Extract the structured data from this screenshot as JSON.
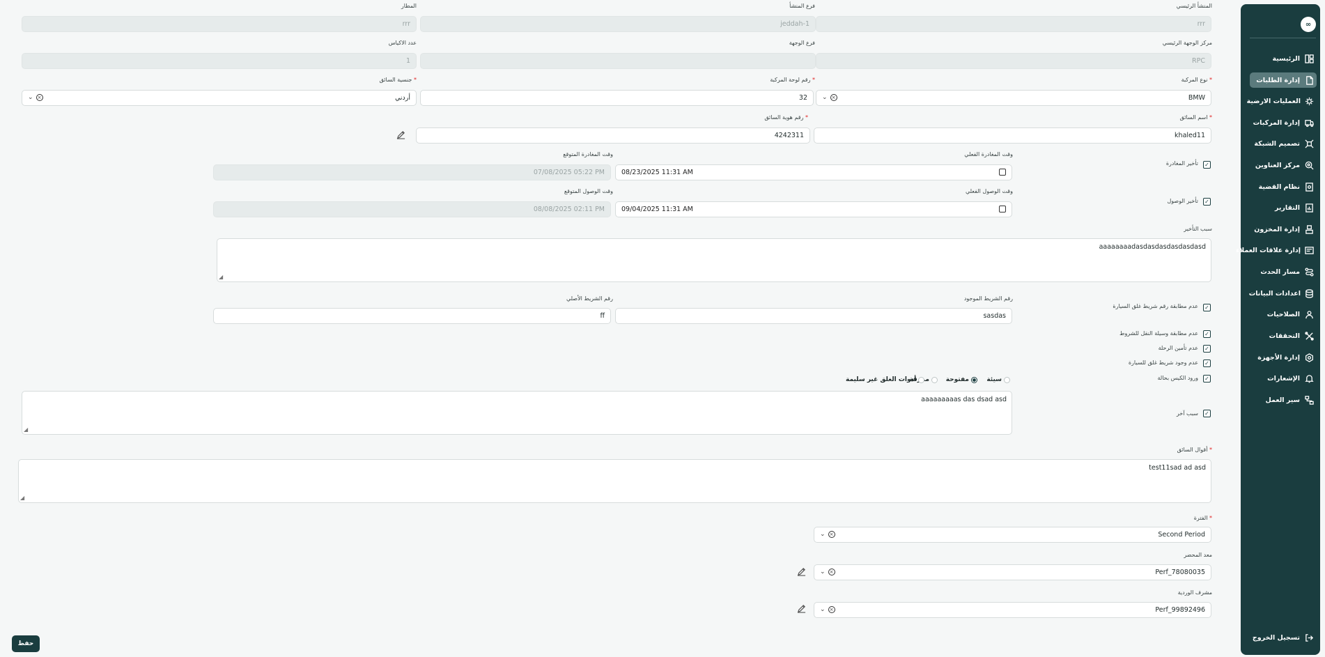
{
  "sidebar": {
    "logo": "∞",
    "items": [
      {
        "label": "الرئيسية",
        "icon": "dashboard-icon"
      },
      {
        "label": "إدارة الطلبات",
        "icon": "orders-icon"
      },
      {
        "label": "العمليات الارضية",
        "icon": "ground-ops-icon"
      },
      {
        "label": "إدارة المركبات",
        "icon": "truck-icon"
      },
      {
        "label": "تصميم الشبكة",
        "icon": "network-icon"
      },
      {
        "label": "مركز العناوين",
        "icon": "location-icon"
      },
      {
        "label": "نظام القضية",
        "icon": "case-icon"
      },
      {
        "label": "التقارير",
        "icon": "reports-icon"
      },
      {
        "label": "إدارة المخزون",
        "icon": "inventory-icon"
      },
      {
        "label": "إدارة علاقات العملاء",
        "icon": "crm-icon"
      },
      {
        "label": "مسار الحدث",
        "icon": "route-icon"
      },
      {
        "label": "اعدادات البيانات",
        "icon": "database-icon"
      },
      {
        "label": "الصلاحيات",
        "icon": "users-icon"
      },
      {
        "label": "التحققات",
        "icon": "tools-icon"
      },
      {
        "label": "إدارة الأجهزة",
        "icon": "device-icon"
      },
      {
        "label": "الإشعارات",
        "icon": "bell-icon"
      },
      {
        "label": "سير العمل",
        "icon": "workflow-icon"
      }
    ],
    "active_index": 1,
    "logout": "تسجيل الخروج"
  },
  "form": {
    "origin_main": {
      "label": "المنشأ الرئيسي",
      "value": "rrr"
    },
    "origin_branch": {
      "label": "فرع المنشأ",
      "value": "jeddah-1"
    },
    "airport": {
      "label": "المطار",
      "value": "rrr"
    },
    "dest_center": {
      "label": "مركز الوجهة الرئيسي",
      "value": "RPC"
    },
    "dest_branch": {
      "label": "فرع الوجهة",
      "value": ""
    },
    "bags_count": {
      "label": "عدد الاكياس",
      "value": "1"
    },
    "vehicle_type": {
      "label": "نوع المركبة",
      "value": "BMW"
    },
    "plate_number": {
      "label": "رقم لوحة المركبة",
      "value": "32"
    },
    "driver_nationality": {
      "label": "جنسية السائق",
      "value": "أردني"
    },
    "driver_name": {
      "label": "اسم السائق",
      "value": "khaled11"
    },
    "driver_id": {
      "label": "رقم هوية السائق",
      "value": "4242311"
    },
    "departure_delay": {
      "label": "تأخير المغادرة",
      "checked": true
    },
    "actual_departure": {
      "label": "وقت المغادرة الفعلي",
      "value": "08/23/2025 11:31 AM"
    },
    "expected_departure": {
      "label": "وقت المغادرة المتوقع",
      "value": "07/08/2025 05:22 PM"
    },
    "arrival_delay": {
      "label": "تأخير الوصول",
      "checked": true
    },
    "actual_arrival": {
      "label": "وقت الوصول الفعلي",
      "value": "09/04/2025 11:31 AM"
    },
    "expected_arrival": {
      "label": "وقت الوصول المتوقع",
      "value": "08/08/2025 02:11 PM"
    },
    "delay_reason": {
      "label": "سبب التأخير",
      "value": "aaaaaaaadasdasdasdasdasdasd"
    },
    "seal_mismatch": {
      "label": "عدم مطابقة رقم شريط غلق السيارة",
      "checked": true
    },
    "existing_seal": {
      "label": "رقم الشريط الموجود",
      "value": "sasdas"
    },
    "original_seal": {
      "label": "رقم الشريط الأصلي",
      "value": "ff"
    },
    "transport_mismatch": {
      "label": "عدم مطابقة وسيلة النقل للشروط",
      "checked": true
    },
    "trip_not_secured": {
      "label": "عدم تأمين الرحلة",
      "checked": true
    },
    "no_seal": {
      "label": "عدم وجود شريط غلق للسيارة",
      "checked": true
    },
    "bag_condition": {
      "label": "ورود الكيس بحالة",
      "checked": true
    },
    "bag_options": [
      "سيئة",
      "مفتوحة",
      "ممزقة",
      "أدوات الغلق غير سليمة"
    ],
    "bag_selected": 1,
    "other_reason": {
      "label": "سبب آخر",
      "checked": true,
      "value": "aaaaaaaaas das dsad asd"
    },
    "driver_statement": {
      "label": "أقوال السائق",
      "value": "test11sad ad asd"
    },
    "period": {
      "label": "الفترة",
      "value": "Second Period"
    },
    "report_author": {
      "label": "معد المحضر",
      "value": "Perf_78080035"
    },
    "shift_supervisor": {
      "label": "مشرف الوردية",
      "value": "Perf_99892496"
    }
  },
  "save_label": "حفظ",
  "colors": {
    "primary": "#1a3d3f",
    "active": "#5b7b7d",
    "required": "#e02020"
  }
}
